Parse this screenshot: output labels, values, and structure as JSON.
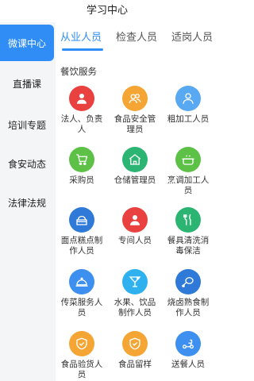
{
  "header": {
    "title": "学习中心"
  },
  "sidebar": {
    "items": [
      {
        "label": "微课中心"
      },
      {
        "label": "直播课"
      },
      {
        "label": "培训专题"
      },
      {
        "label": "食安动态"
      },
      {
        "label": "法律法规"
      }
    ]
  },
  "tabs": [
    {
      "label": "从业人员"
    },
    {
      "label": "检查人员"
    },
    {
      "label": "适岗人员"
    }
  ],
  "section": {
    "title": "餐饮服务"
  },
  "roles": [
    {
      "label": "法人、负责人",
      "icon": "person-icon",
      "color": "#e9413f"
    },
    {
      "label": "食品安全管理员",
      "icon": "group-icon",
      "color": "#f5a533"
    },
    {
      "label": "粗加工人员",
      "icon": "user-icon",
      "color": "#58a8f2"
    },
    {
      "label": "采购员",
      "icon": "cart-icon",
      "color": "#5cc146"
    },
    {
      "label": "仓储管理员",
      "icon": "house-icon",
      "color": "#2cb572"
    },
    {
      "label": "烹调加工人员",
      "icon": "pot-icon",
      "color": "#5cc146"
    },
    {
      "label": "面点糕点制作人员",
      "icon": "cake-icon",
      "color": "#2f79d8"
    },
    {
      "label": "专间人员",
      "icon": "person-icon",
      "color": "#e9413f"
    },
    {
      "label": "餐具清洗消毒保洁",
      "icon": "cutlery-icon",
      "color": "#2cb572"
    },
    {
      "label": "传菜服务人员",
      "icon": "cloche-icon",
      "color": "#3d8ff0"
    },
    {
      "label": "水果、饮品制作人员",
      "icon": "cocktail-icon",
      "color": "#2fb1ef"
    },
    {
      "label": "烧卤熟食制作人员",
      "icon": "meat-icon",
      "color": "#2f79d8"
    },
    {
      "label": "食品验货人员",
      "icon": "shield-check-icon",
      "color": "#f5a533"
    },
    {
      "label": "食品留样",
      "icon": "shield-check-icon",
      "color": "#f5a533"
    },
    {
      "label": "送餐人员",
      "icon": "scooter-icon",
      "color": "#3d8ff0"
    }
  ]
}
